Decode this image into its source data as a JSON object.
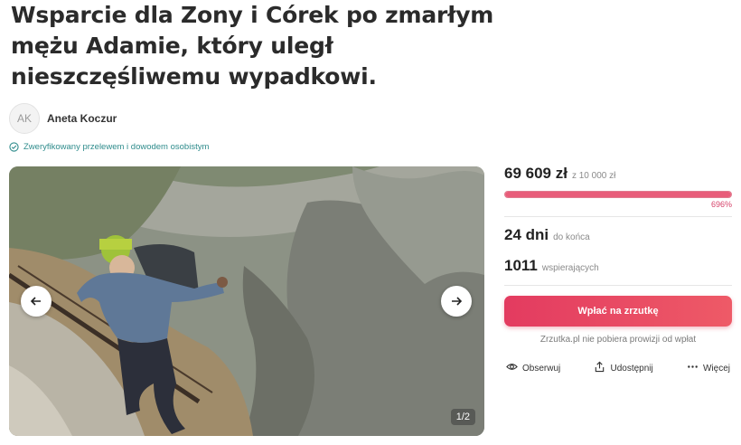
{
  "page": {
    "title": "Wsparcie dla Zony i Córek po zmarłym mężu Adamie, który uległ nieszczęśliwemu wypadkowi."
  },
  "author": {
    "initials": "AK",
    "name": "Aneta Koczur",
    "verified_text": "Zweryfikowany przelewem i dowodem osobistym"
  },
  "gallery": {
    "counter": "1/2"
  },
  "fundraiser": {
    "raised": "69 609 zł",
    "goal": "z 10 000 zł",
    "percent": "696%",
    "progress_fraction": 1.0,
    "days_left": "24 dni",
    "days_left_label": "do końca",
    "supporters": "1011",
    "supporters_label": "wspierających",
    "donate_label": "Wpłać na zrzutkę",
    "no_fee_text": "Zrzutka.pl nie pobiera prowizji od wpłat"
  },
  "actions": {
    "observe": "Obserwuj",
    "share": "Udostępnij",
    "more": "Więcej"
  },
  "colors": {
    "accent": "#e33b60",
    "verified": "#2f8c8c",
    "percent": "#d6426a"
  }
}
